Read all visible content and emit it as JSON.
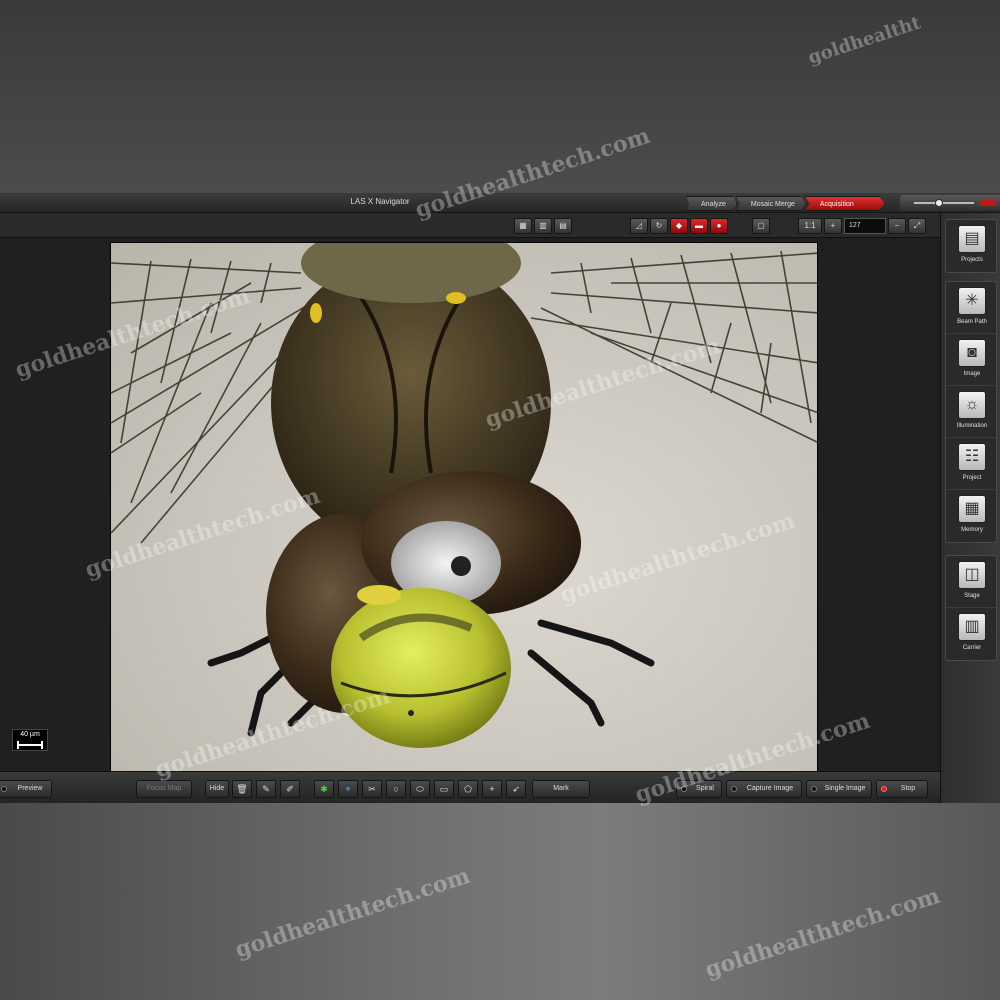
{
  "window": {
    "title": "LAS X Navigator"
  },
  "mode_tabs": [
    {
      "label": "Analyze",
      "active": false
    },
    {
      "label": "Mosaic Merge",
      "active": false
    },
    {
      "label": "Acquisition",
      "active": true
    }
  ],
  "toolbar": {
    "zoom_ratio": "1:1",
    "zoom_value": "127"
  },
  "image": {
    "subject": "dragonfly head and thorax, macro",
    "scale_bar": "40 µm"
  },
  "right_panel": {
    "group1": [
      {
        "label": "Projects",
        "icon": "projects-icon"
      }
    ],
    "group2": [
      {
        "label": "Beam Path",
        "icon": "beam-path-icon"
      },
      {
        "label": "Image",
        "icon": "camera-icon"
      },
      {
        "label": "Illumination",
        "icon": "lightbulb-icon"
      },
      {
        "label": "Project",
        "icon": "project-icon"
      },
      {
        "label": "Memory",
        "icon": "memory-chip-icon"
      }
    ],
    "group3": [
      {
        "label": "Stage",
        "icon": "stage-icon"
      },
      {
        "label": "Carrier",
        "icon": "carrier-icon"
      }
    ]
  },
  "bottom_bar": {
    "preview": "Preview",
    "focus_map": "Focus Map",
    "hide": "Hide",
    "mark": "Mark",
    "spiral": "Spiral",
    "capture_image": "Capture Image",
    "single_image": "Single Image",
    "stop": "Stop"
  },
  "watermark": "goldhealthtech.com",
  "watermark_short": "goldhealtht",
  "colors": {
    "accent": "#d41f1f",
    "panel": "#2a2a2a",
    "background": "#1f1f1f"
  }
}
